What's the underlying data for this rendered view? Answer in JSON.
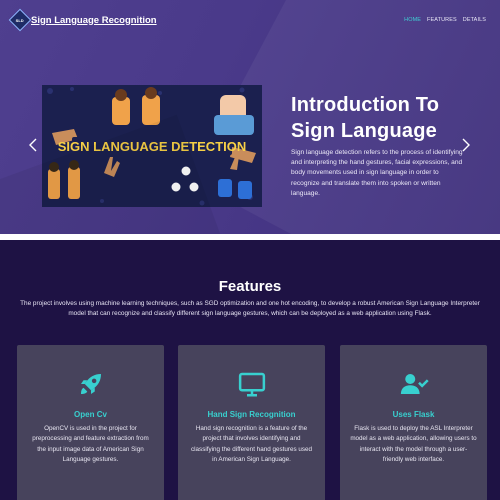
{
  "nav": {
    "brand_badge": "SLD",
    "brand": "Sign Language Recognition",
    "links": [
      "HOME",
      "FEATURES",
      "DETAILS"
    ]
  },
  "hero": {
    "image_text": "SIGN LANGUAGE DETECTION",
    "title": "Introduction To Sign Language",
    "description": "Sign language detection refers to the process of identifying and interpreting the hand gestures, facial expressions, and body movements used in sign language in order to recognize and translate them into spoken or written language.",
    "prev_icon": "chevron-left-icon",
    "next_icon": "chevron-right-icon"
  },
  "features": {
    "heading": "Features",
    "intro": "The project involves using machine learning techniques, such as SGD optimization and one hot encoding, to develop a robust American Sign Language Interpreter model that can recognize and classify different sign language gestures, which can be deployed as a web application using Flask.",
    "cards": [
      {
        "icon": "rocket-icon",
        "title": "Open Cv",
        "text": "OpenCV is used in the project for preprocessing and feature extraction from the input image data of American Sign Language gestures."
      },
      {
        "icon": "monitor-icon",
        "title": "Hand Sign Recognition",
        "text": "Hand sign recognition is a feature of the project that involves identifying and classifying the different hand gestures used in American Sign Language."
      },
      {
        "icon": "user-check-icon",
        "title": "Uses Flask",
        "text": "Flask is used to deploy the ASL Interpreter model as a web application, allowing users to interact with the model through a user-friendly web interface."
      }
    ]
  },
  "colors": {
    "hero_bg": "#4a3a8a",
    "features_bg": "#1e1244",
    "card_bg": "#47435c",
    "accent": "#38d0cf"
  }
}
